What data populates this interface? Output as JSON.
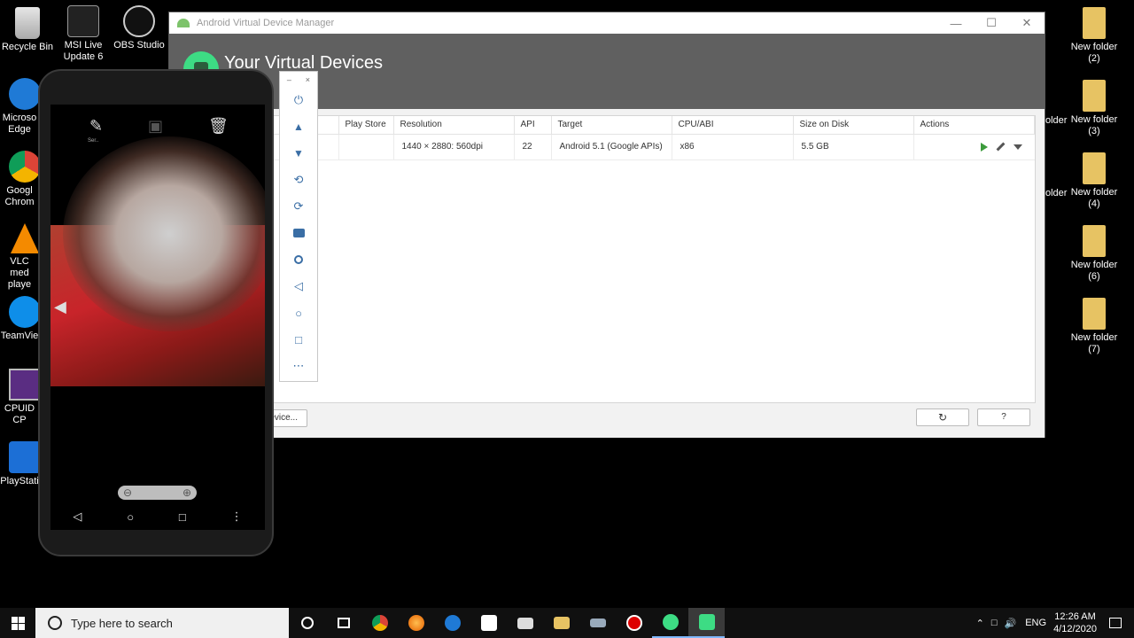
{
  "desktop": {
    "left_icons": [
      {
        "label": "Recycle Bin"
      },
      {
        "label": "MSI Live Update 6"
      },
      {
        "label": "OBS Studio"
      },
      {
        "label": "Microso Edge"
      },
      {
        "label": "Googl Chrom"
      },
      {
        "label": "VLC med playe"
      },
      {
        "label": "TeamVie"
      },
      {
        "label": "CPUID CP"
      },
      {
        "label": "PlayStati"
      }
    ],
    "right_icons": [
      {
        "label": "New folder (2)"
      },
      {
        "label": "New folder (3)"
      },
      {
        "label": "New folder (4)"
      },
      {
        "label": "New folder (6)"
      },
      {
        "label": "New folder (7)"
      }
    ],
    "partial_labels": [
      "c",
      "older",
      "older"
    ]
  },
  "avd_window": {
    "title": "Android Virtual Device Manager",
    "heading": "Your Virtual Devices",
    "columns": [
      "Play Store",
      "Resolution",
      "API",
      "Target",
      "CPU/ABI",
      "Size on Disk",
      "Actions"
    ],
    "rows": [
      {
        "play_store": "",
        "resolution": "1440 × 2880: 560dpi",
        "api": "22",
        "target": "Android 5.1 (Google APIs)",
        "cpu": "x86",
        "size": "5.5 GB"
      }
    ],
    "create_button": "evice...",
    "refresh_icon": "refresh-icon",
    "help_button": "?"
  },
  "emulator": {
    "top_controls": [
      "–",
      "×"
    ],
    "toolbar": [
      {
        "name": "power-icon",
        "glyph": "⏻"
      },
      {
        "name": "volume-up-icon",
        "glyph": "🔊"
      },
      {
        "name": "volume-down-icon",
        "glyph": "🔉"
      },
      {
        "name": "rotate-left-icon",
        "glyph": "⟲"
      },
      {
        "name": "rotate-right-icon",
        "glyph": "⟳"
      },
      {
        "name": "camera-icon",
        "glyph": "📷"
      },
      {
        "name": "zoom-icon",
        "glyph": "🔍"
      },
      {
        "name": "back-icon",
        "glyph": "◁"
      },
      {
        "name": "home-icon",
        "glyph": "○"
      },
      {
        "name": "overview-icon",
        "glyph": "□"
      },
      {
        "name": "more-icon",
        "glyph": "⋯"
      }
    ],
    "screen": {
      "top_label": "Ser..",
      "nav": [
        "◁",
        "○",
        "□",
        "⋮"
      ]
    }
  },
  "taskbar": {
    "search_placeholder": "Type here to search",
    "language": "ENG",
    "time": "12:26 AM",
    "date": "4/12/2020",
    "accent": "#0078d7"
  }
}
